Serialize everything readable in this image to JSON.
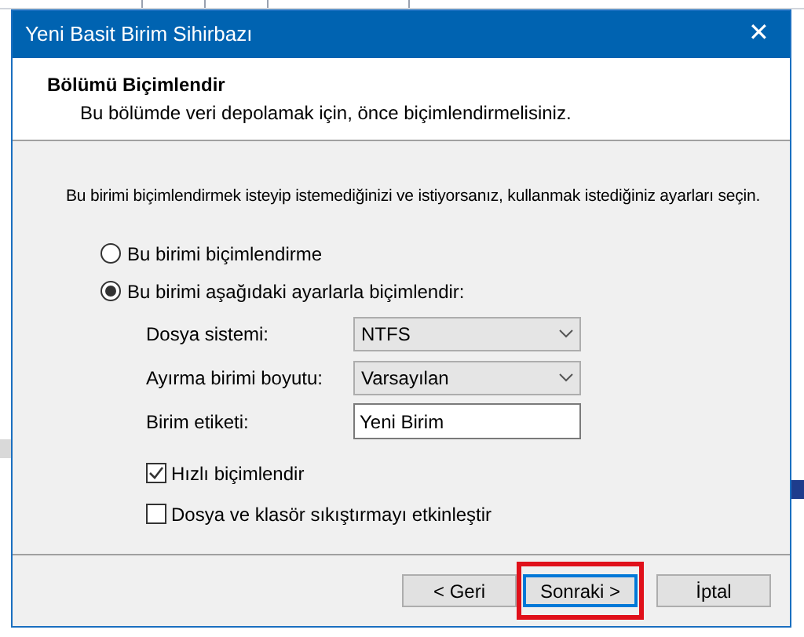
{
  "window": {
    "title": "Yeni Basit Birim Sihirbazı",
    "close": "✕"
  },
  "header": {
    "title": "Bölümü Biçimlendir",
    "subtitle": "Bu bölümde veri depolamak için, önce biçimlendirmelisiniz."
  },
  "intro": "Bu birimi biçimlendirmek isteyip istemediğinizi ve istiyorsanız, kullanmak istediğiniz ayarları seçin.",
  "options": [
    {
      "label": "Bu birimi biçimlendirme",
      "selected": false
    },
    {
      "label": "Bu birimi aşağıdaki ayarlarla biçimlendir:",
      "selected": true
    }
  ],
  "fields": [
    {
      "kind": "dropdown",
      "label": "Dosya sistemi:",
      "value": "NTFS"
    },
    {
      "kind": "dropdown",
      "label": "Ayırma birimi boyutu:",
      "value": "Varsayılan"
    },
    {
      "kind": "text",
      "label": "Birim etiketi:",
      "value": "Yeni Birim"
    }
  ],
  "checkboxes": [
    {
      "label": "Hızlı biçimlendir",
      "checked": true
    },
    {
      "label": "Dosya ve klasör sıkıştırmayı etkinleştir",
      "checked": false
    }
  ],
  "buttons": [
    {
      "label": "< Geri",
      "focused": false,
      "highlighted": false
    },
    {
      "label": "Sonraki >",
      "focused": true,
      "highlighted": true
    },
    {
      "label": "İptal",
      "focused": false,
      "highlighted": false
    }
  ]
}
